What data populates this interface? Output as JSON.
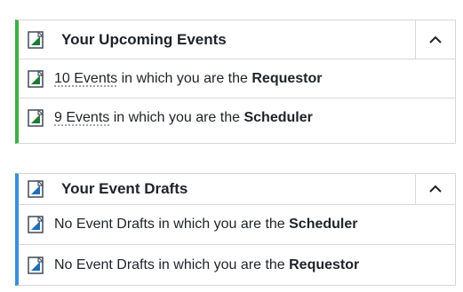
{
  "upcoming": {
    "title": "Your Upcoming Events",
    "rows": [
      {
        "count_text": "10 Events",
        "middle": " in which you are the ",
        "role": "Requestor"
      },
      {
        "count_text": "9 Events",
        "middle": " in which you are the ",
        "role": "Scheduler"
      }
    ],
    "accent": "#3fae49"
  },
  "drafts": {
    "title": "Your Event Drafts",
    "rows": [
      {
        "text": "No Event Drafts in which you are the ",
        "role": "Scheduler"
      },
      {
        "text": "No Event Drafts in which you are the ",
        "role": "Requestor"
      }
    ],
    "accent": "#3a8fd8"
  },
  "icons": {
    "document": "document-icon",
    "collapse": "chevron-up-icon"
  }
}
